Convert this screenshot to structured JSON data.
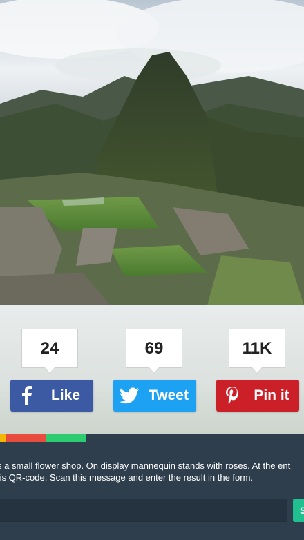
{
  "share": {
    "facebook": {
      "count": "24",
      "label": "Like",
      "icon": "facebook-icon",
      "color": "#3b5aa3"
    },
    "twitter": {
      "count": "69",
      "label": "Tweet",
      "icon": "twitter-icon",
      "color": "#1da1f2"
    },
    "pinterest": {
      "count": "11K",
      "label": "Pin it",
      "icon": "pinterest-icon",
      "color": "#cb2027"
    }
  },
  "color_bar": [
    "#f2b705",
    "#e74c3c",
    "#2ecc71"
  ],
  "panel": {
    "line1": "re is a small flower shop. On display mannequin stands with roses. At the ent",
    "line2": "ent is QR-code. Scan this message and enter the result in the form.",
    "input_placeholder": "",
    "submit_label": "S"
  }
}
